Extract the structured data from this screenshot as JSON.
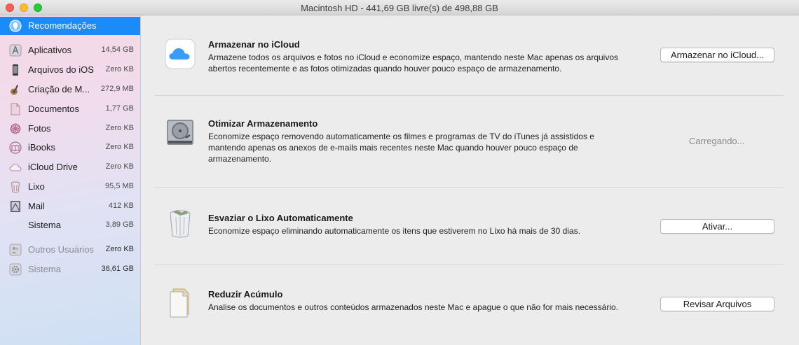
{
  "window": {
    "title": "Macintosh HD - 441,69 GB livre(s) de 498,88 GB"
  },
  "sidebar": {
    "items": [
      {
        "label": "Recomendações",
        "size": "",
        "icon": "recommendations-icon"
      },
      {
        "label": "Aplicativos",
        "size": "14,54 GB",
        "icon": "applications-icon"
      },
      {
        "label": "Arquivos do iOS",
        "size": "Zero KB",
        "icon": "iphone-icon"
      },
      {
        "label": "Criação de M...",
        "size": "272,9 MB",
        "icon": "guitar-icon"
      },
      {
        "label": "Documentos",
        "size": "1,77 GB",
        "icon": "document-icon"
      },
      {
        "label": "Fotos",
        "size": "Zero KB",
        "icon": "photos-icon"
      },
      {
        "label": "iBooks",
        "size": "Zero KB",
        "icon": "ibooks-icon"
      },
      {
        "label": "iCloud Drive",
        "size": "Zero KB",
        "icon": "cloud-icon"
      },
      {
        "label": "Lixo",
        "size": "95,5 MB",
        "icon": "trash-icon"
      },
      {
        "label": "Mail",
        "size": "412 KB",
        "icon": "mail-icon"
      },
      {
        "label": "Sistema",
        "size": "3,89 GB",
        "icon": ""
      },
      {
        "label": "Outros Usuários",
        "size": "Zero KB",
        "icon": "users-icon"
      },
      {
        "label": "Sistema",
        "size": "36,61 GB",
        "icon": "gear-icon"
      }
    ]
  },
  "recommendations": [
    {
      "title": "Armazenar no iCloud",
      "description": "Armazene todos os arquivos e fotos no iCloud e economize espaço, mantendo neste Mac apenas os arquivos abertos recentemente e as fotos otimizadas quando houver pouco espaço de armazenamento.",
      "action": "Armazenar no iCloud...",
      "icon": "icloud-icon"
    },
    {
      "title": "Otimizar Armazenamento",
      "description": "Economize espaço removendo automaticamente os filmes e programas de TV do iTunes já assistidos e mantendo apenas os anexos de e-mails mais recentes neste Mac quando houver pouco espaço de armazenamento.",
      "status": "Carregando...",
      "icon": "hard-drive-icon"
    },
    {
      "title": "Esvaziar o Lixo Automaticamente",
      "description": "Economize espaço eliminando automaticamente os itens que estiverem no Lixo há mais de 30 dias.",
      "action": "Ativar...",
      "icon": "full-trash-icon"
    },
    {
      "title": "Reduzir Acúmulo",
      "description": "Analise os documentos e outros conteúdos armazenados neste Mac e apague o que não for mais necessário.",
      "action": "Revisar Arquivos",
      "icon": "documents-stack-icon"
    }
  ],
  "colors": {
    "selection": "#1a8bf8",
    "close": "#fc5f57",
    "minimize": "#fdbc2e",
    "maximize": "#28c840"
  }
}
